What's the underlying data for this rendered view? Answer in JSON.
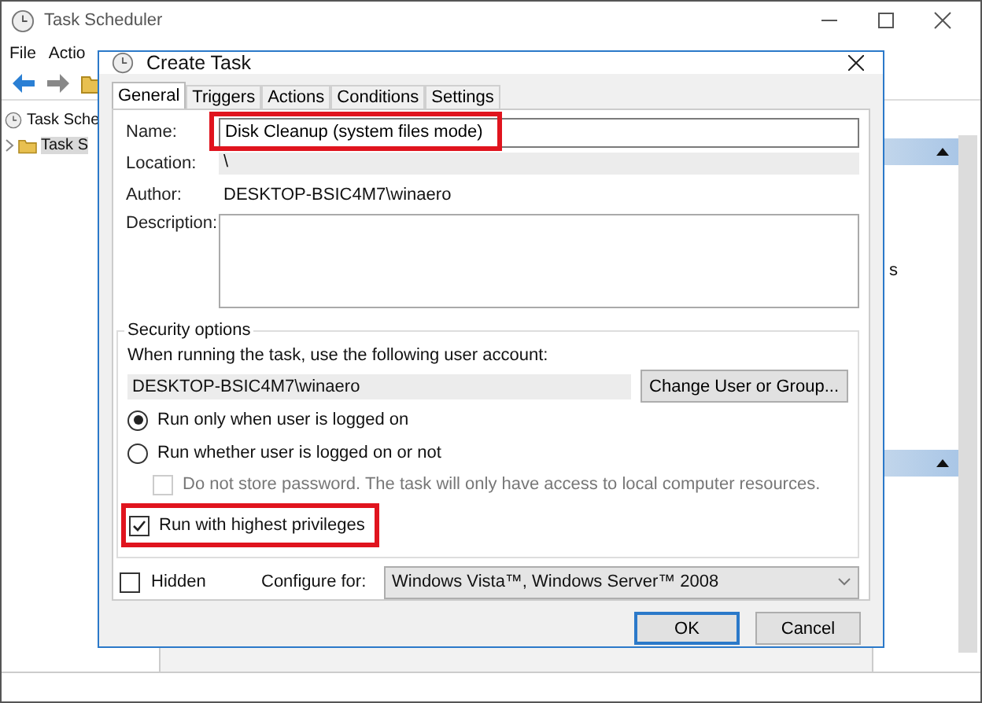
{
  "background_window": {
    "title": "Task Scheduler",
    "menu": [
      "File",
      "Actio"
    ],
    "tree": [
      {
        "label": "Task Sche",
        "children": [
          {
            "label": "Task S",
            "selected": true
          }
        ]
      }
    ],
    "actions_pane_text": "s"
  },
  "dialog": {
    "title": "Create Task",
    "tabs": [
      {
        "label": "General",
        "selected": true
      },
      {
        "label": "Triggers",
        "selected": false
      },
      {
        "label": "Actions",
        "selected": false
      },
      {
        "label": "Conditions",
        "selected": false
      },
      {
        "label": "Settings",
        "selected": false
      }
    ],
    "name": {
      "label": "Name:",
      "value": "Disk Cleanup (system files mode)",
      "highlighted": true
    },
    "location": {
      "label": "Location:",
      "value": "\\"
    },
    "author": {
      "label": "Author:",
      "value": "DESKTOP-BSIC4M7\\winaero"
    },
    "description": {
      "label": "Description:"
    },
    "security": {
      "title": "Security options",
      "account_prompt": "When running the task, use the following user account:",
      "account": "DESKTOP-BSIC4M7\\winaero",
      "change_button": "Change User or Group...",
      "options": [
        {
          "kind": "radio",
          "label": "Run only when user is logged on",
          "selected": true,
          "highlighted": false
        },
        {
          "kind": "radio",
          "label": "Run whether user is logged on or not",
          "selected": false,
          "highlighted": false,
          "children": [
            {
              "kind": "checkbox",
              "label": "Do not store password.  The task will only have access to local computer resources.",
              "checked": false,
              "disabled": true
            }
          ]
        },
        {
          "kind": "checkbox",
          "label": "Run with highest privileges",
          "checked": true,
          "disabled": false,
          "highlighted": true
        }
      ]
    },
    "hidden": {
      "label": "Hidden",
      "checked": false
    },
    "configure": {
      "label": "Configure for:",
      "value": "Windows Vista™, Windows Server™ 2008"
    },
    "buttons": [
      {
        "label": "OK",
        "default": true
      },
      {
        "label": "Cancel",
        "default": false
      }
    ]
  }
}
